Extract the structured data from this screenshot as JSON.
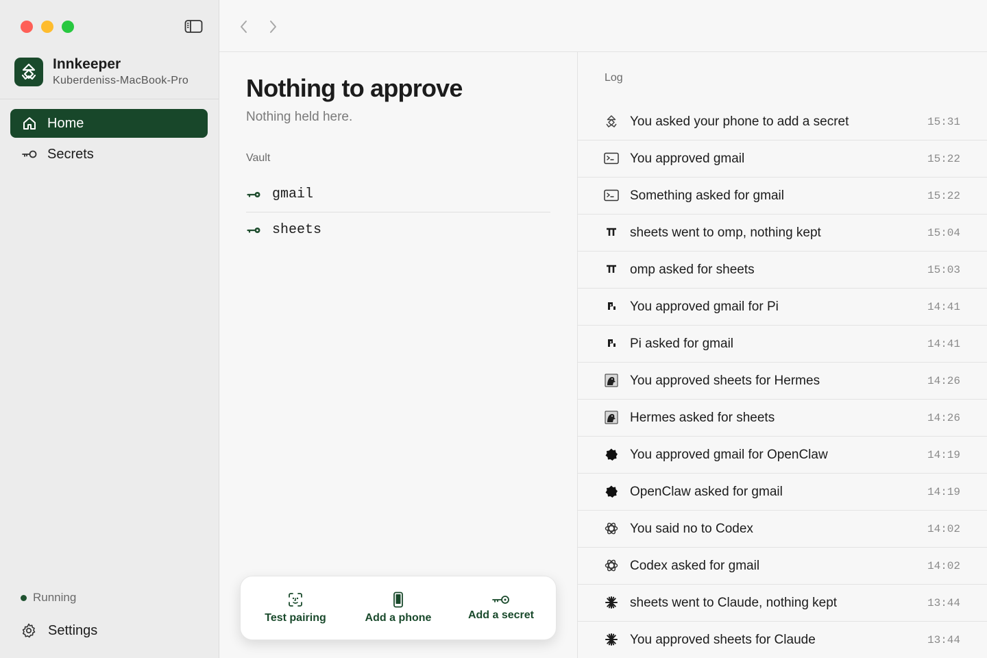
{
  "window": {
    "traffic_lights": [
      "close",
      "minimize",
      "zoom"
    ]
  },
  "sidebar": {
    "app_name": "Innkeeper",
    "machine_name": "Kuberdeniss-MacBook-Pro",
    "items": [
      {
        "label": "Home",
        "icon": "home-icon",
        "active": true
      },
      {
        "label": "Secrets",
        "icon": "key-icon",
        "active": false
      }
    ],
    "status": "Running",
    "settings_label": "Settings"
  },
  "main": {
    "title": "Nothing to approve",
    "subtitle": "Nothing held here.",
    "vault_label": "Vault",
    "vault_items": [
      "gmail",
      "sheets"
    ]
  },
  "actions": [
    {
      "label": "Test pairing",
      "icon": "face-scan-icon"
    },
    {
      "label": "Add a phone",
      "icon": "phone-icon"
    },
    {
      "label": "Add a secret",
      "icon": "key-icon"
    }
  ],
  "log": {
    "label": "Log",
    "entries": [
      {
        "text": "You asked your phone to add a secret",
        "time": "15:31",
        "icon": "innkeeper-icon"
      },
      {
        "text": "You approved gmail",
        "time": "15:22",
        "icon": "terminal-icon"
      },
      {
        "text": "Something asked for gmail",
        "time": "15:22",
        "icon": "terminal-icon"
      },
      {
        "text": "sheets went to omp, nothing kept",
        "time": "15:04",
        "icon": "omp-icon"
      },
      {
        "text": "omp asked for sheets",
        "time": "15:03",
        "icon": "omp-icon"
      },
      {
        "text": "You approved gmail for Pi",
        "time": "14:41",
        "icon": "pi-icon"
      },
      {
        "text": "Pi asked for gmail",
        "time": "14:41",
        "icon": "pi-icon"
      },
      {
        "text": "You approved sheets for Hermes",
        "time": "14:26",
        "icon": "hermes-icon"
      },
      {
        "text": "Hermes asked for sheets",
        "time": "14:26",
        "icon": "hermes-icon"
      },
      {
        "text": "You approved gmail for OpenClaw",
        "time": "14:19",
        "icon": "openclaw-icon"
      },
      {
        "text": "OpenClaw asked for gmail",
        "time": "14:19",
        "icon": "openclaw-icon"
      },
      {
        "text": "You said no to Codex",
        "time": "14:02",
        "icon": "codex-icon"
      },
      {
        "text": "Codex asked for gmail",
        "time": "14:02",
        "icon": "codex-icon"
      },
      {
        "text": "sheets went to Claude, nothing kept",
        "time": "13:44",
        "icon": "claude-icon"
      },
      {
        "text": "You approved sheets for Claude",
        "time": "13:44",
        "icon": "claude-icon"
      }
    ]
  },
  "colors": {
    "accent": "#18472a",
    "close": "#fe5f57",
    "minimize": "#febc2e",
    "zoom": "#28c840"
  }
}
